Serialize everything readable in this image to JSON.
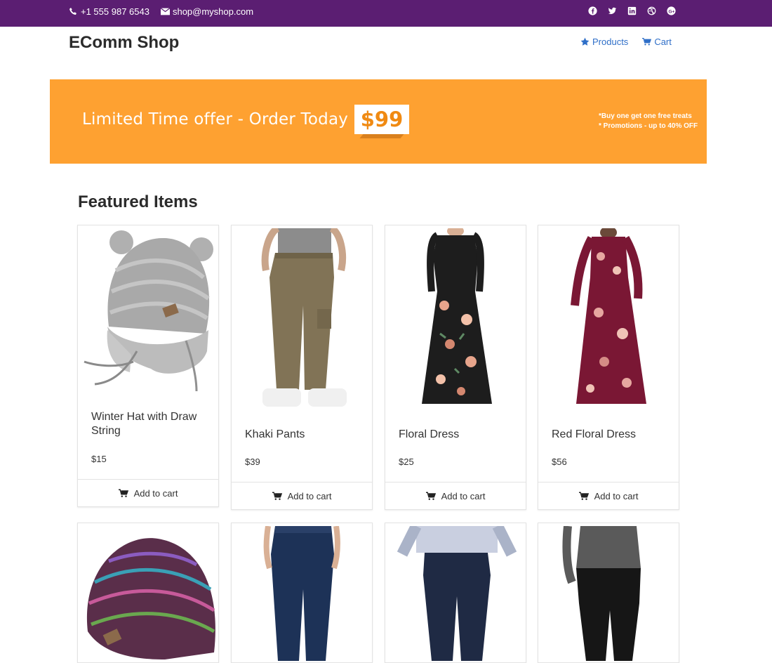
{
  "topbar": {
    "phone": "+1 555 987 6543",
    "email": "shop@myshop.com",
    "social_icons": [
      "facebook-icon",
      "twitter-icon",
      "linkedin-icon",
      "dribbble-icon",
      "google-plus-icon"
    ]
  },
  "header": {
    "brand": "EComm Shop",
    "nav": [
      {
        "label": "Products",
        "icon": "star-icon"
      },
      {
        "label": "Cart",
        "icon": "cart-icon"
      }
    ]
  },
  "banner": {
    "headline": "Limited Time offer - Order Today For",
    "price": "$99",
    "note1": "*Buy one get one free treats",
    "note2": "* Promotions - up to 40% OFF",
    "background": "#fea131"
  },
  "featured": {
    "title": "Featured Items",
    "items": [
      {
        "name": "Winter Hat with Draw String",
        "price": "$15",
        "add_label": "Add to cart"
      },
      {
        "name": "Khaki Pants",
        "price": "$39",
        "add_label": "Add to cart"
      },
      {
        "name": "Floral Dress",
        "price": "$25",
        "add_label": "Add to cart"
      },
      {
        "name": "Red Floral Dress",
        "price": "$56",
        "add_label": "Add to cart"
      }
    ]
  },
  "colors": {
    "topbar": "#5b1e72",
    "link": "#2f6fc8"
  }
}
